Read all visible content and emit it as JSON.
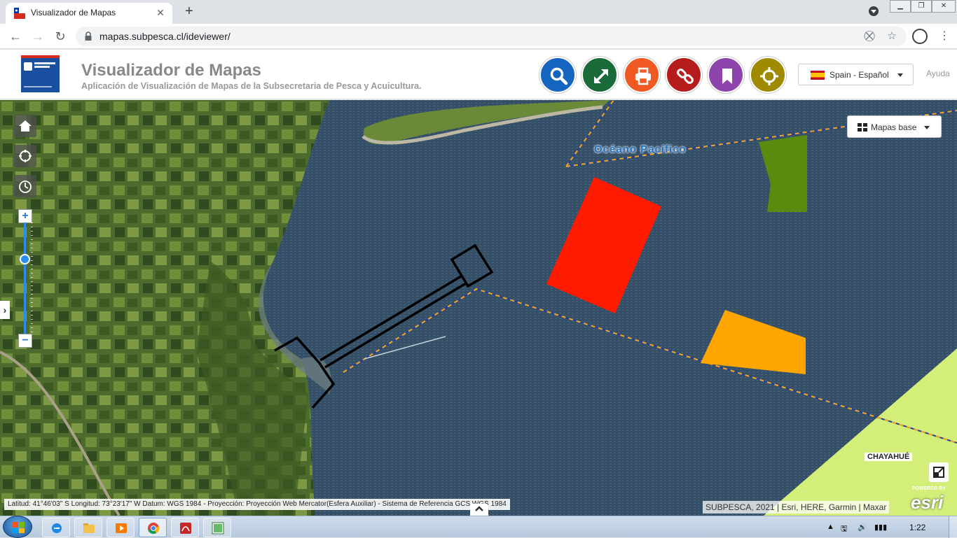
{
  "browser": {
    "tab_title": "Visualizador de Mapas",
    "new_tab": "+",
    "url": "mapas.subpesca.cl/ideviewer/"
  },
  "header": {
    "title": "Visualizador de Mapas",
    "subtitle": "Aplicación de Visualización de Mapas de la Subsecretaria de Pesca y Acuicultura.",
    "language": "Spain - Español",
    "help": "Ayuda",
    "tools": [
      {
        "name": "search",
        "color": "#1565c0"
      },
      {
        "name": "fullscreen",
        "color": "#1b6b3a"
      },
      {
        "name": "print",
        "color": "#f05a22"
      },
      {
        "name": "link",
        "color": "#b71c1c"
      },
      {
        "name": "bookmark",
        "color": "#8e44ad"
      },
      {
        "name": "locate",
        "color": "#a08a00"
      }
    ]
  },
  "map": {
    "basemap_button": "Mapas base",
    "ocean_label": "Océano  Pacífico",
    "place_label": "CHAYAHUÉ",
    "coordinates": "Latitud:  41°46'03\" S Longitud:  73°23'17\" W Datum: WGS 1984 - Proyección: Proyección Web Mercator(Esfera Auxiliar) - Sistema de Referencia GCS WGS 1984",
    "attribution": "SUBPESCA, 2021 | Esri, HERE, Garmin | Maxar",
    "esri_powered": "POWERED BY",
    "esri_logo": "esri",
    "zoom_in": "+",
    "zoom_out": "−",
    "colors": {
      "red_zone": "#ff1a00",
      "orange_zone": "#ffa500",
      "green_zone": "#5a8a0e",
      "lime_zone": "#d4ee7a",
      "boundary_line": "#f5a623"
    }
  },
  "taskbar": {
    "clock": "1:22"
  }
}
